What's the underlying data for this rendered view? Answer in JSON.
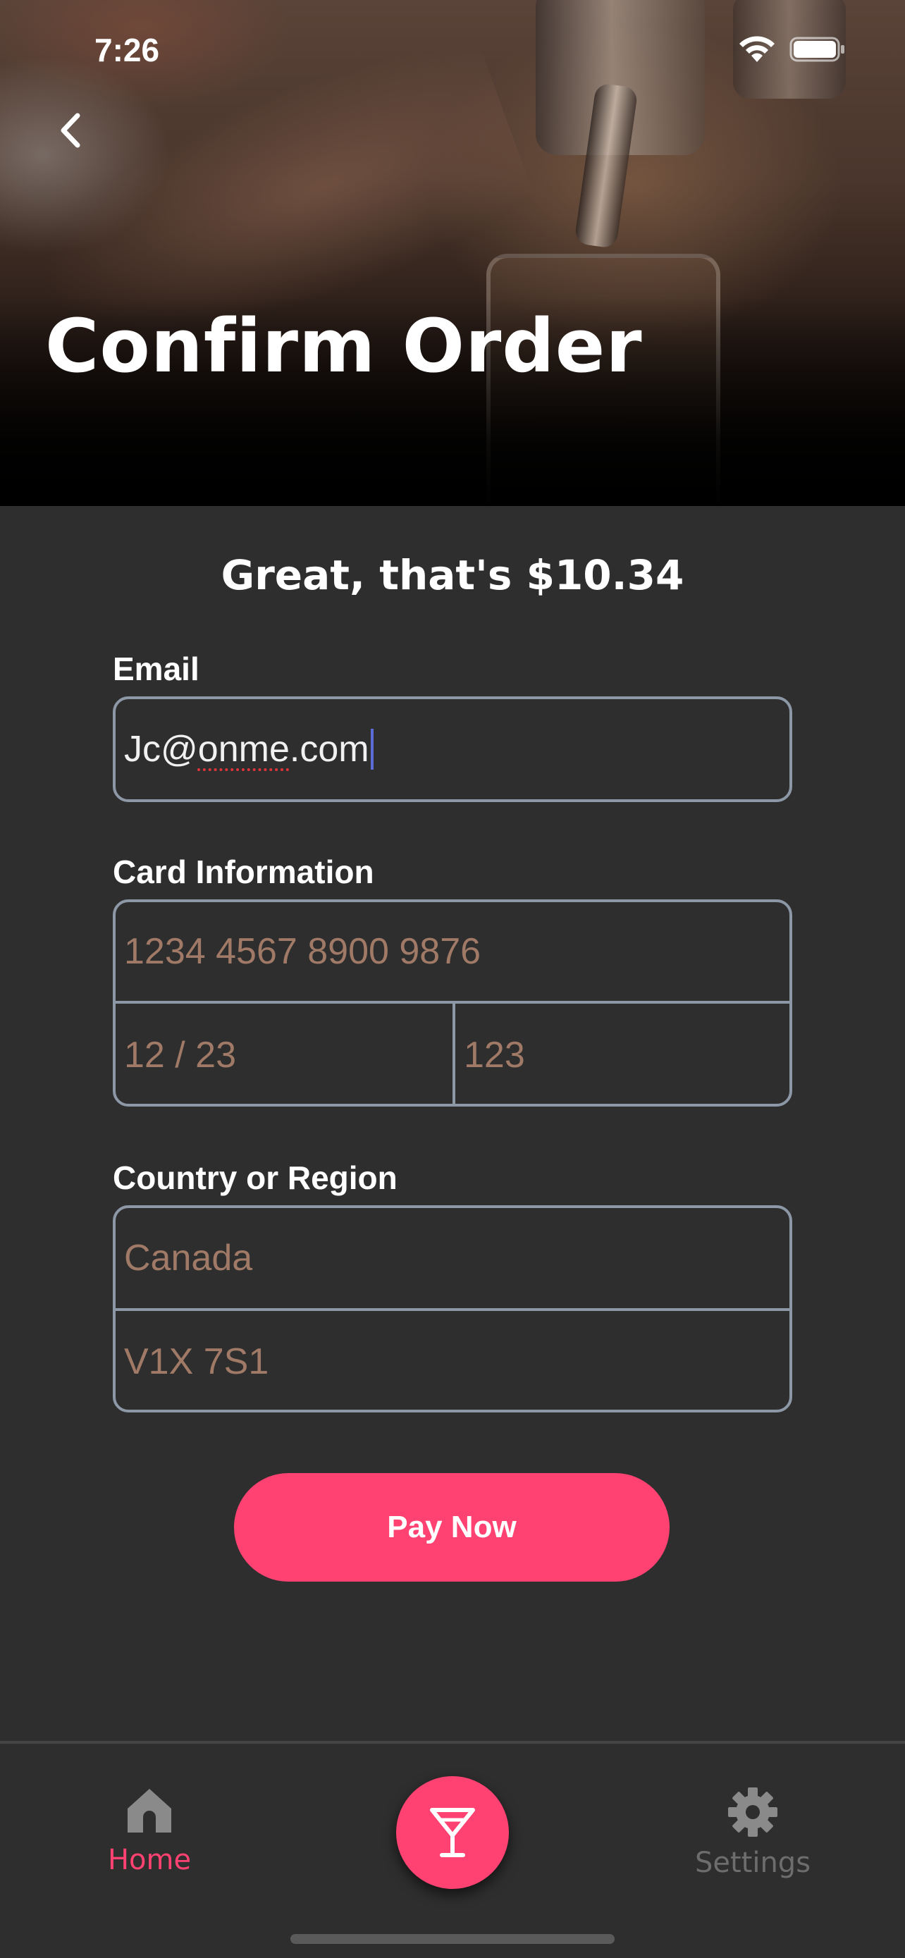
{
  "status_bar": {
    "time": "7:26"
  },
  "header": {
    "title": "Confirm Order",
    "back_icon": "chevron-left-icon"
  },
  "summary": {
    "total_text": "Great, that's $10.34"
  },
  "form": {
    "email": {
      "label": "Email",
      "value": "Jc@onme.com"
    },
    "card": {
      "label": "Card Information",
      "number_placeholder": "1234 4567 8900 9876",
      "expiry_placeholder": "12 / 23",
      "cvc_placeholder": "123"
    },
    "region": {
      "label": "Country or Region",
      "country_placeholder": "Canada",
      "postal_placeholder": "V1X 7S1"
    },
    "pay_label": "Pay Now"
  },
  "tabbar": {
    "home_label": "Home",
    "settings_label": "Settings",
    "center_icon": "cocktail-icon"
  },
  "colors": {
    "accent": "#ff4271",
    "background": "#2e2e2e",
    "field_border": "#8d98a7",
    "placeholder": "#a07a66"
  }
}
